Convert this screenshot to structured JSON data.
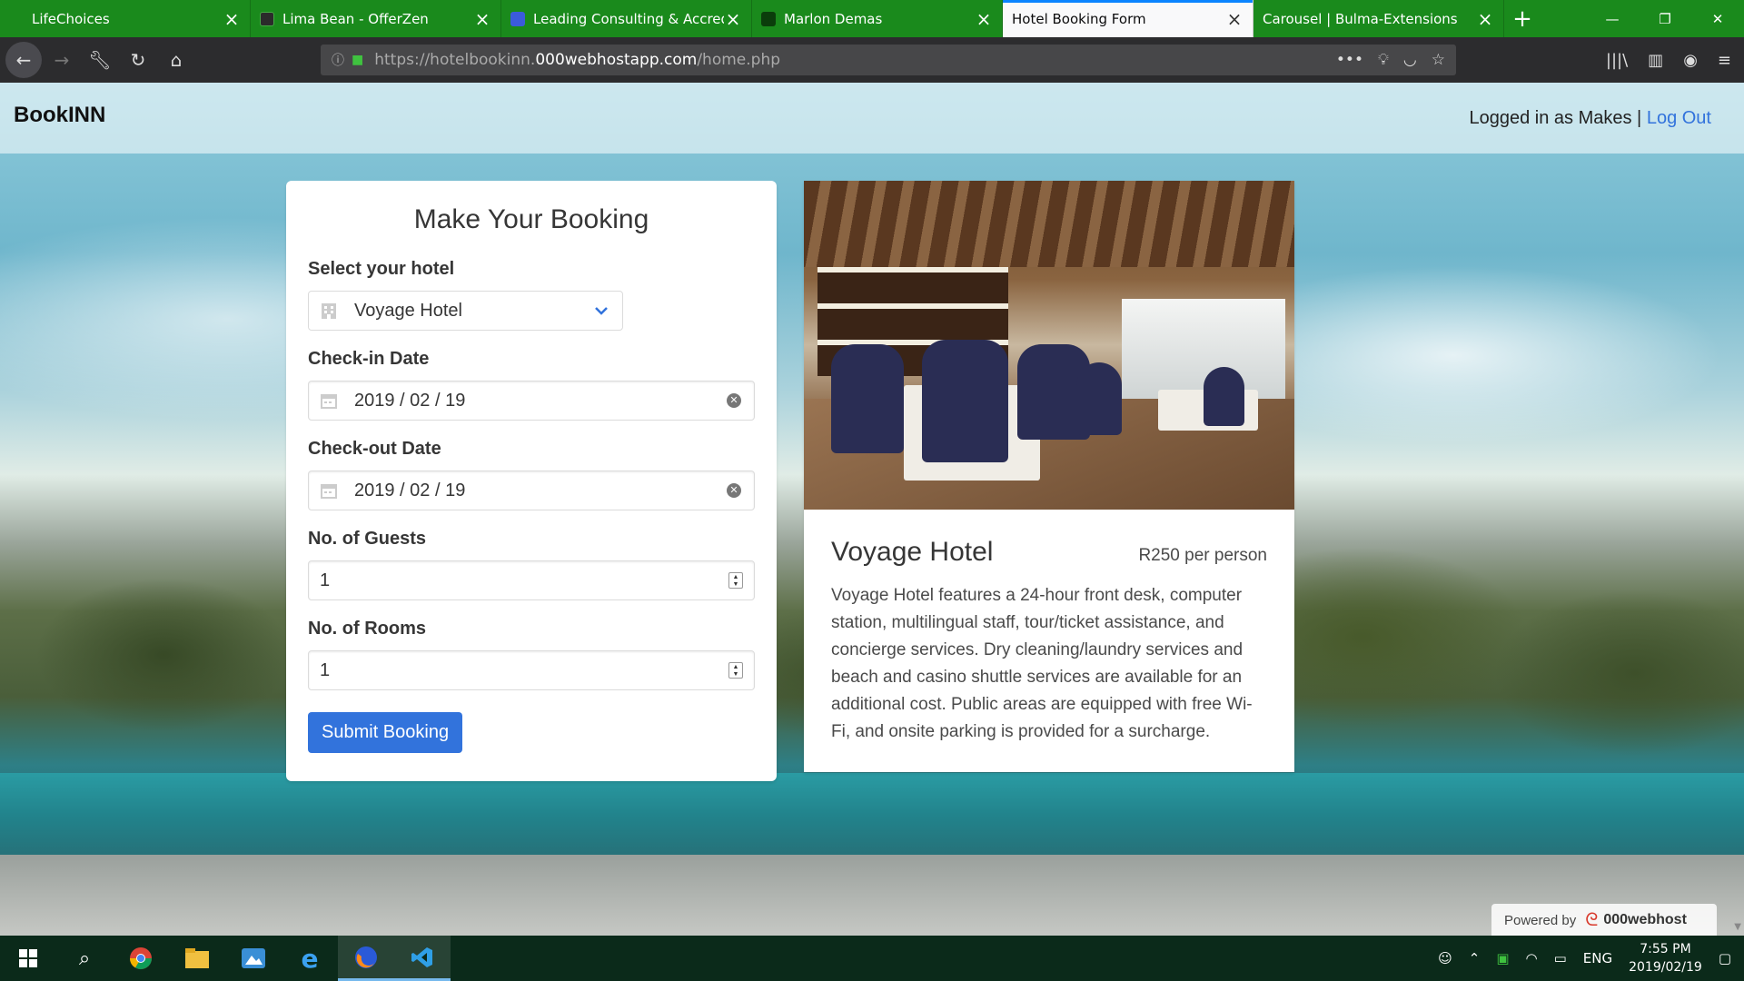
{
  "browser": {
    "tabs": [
      {
        "title": "LifeChoices",
        "icon_color": "#1a8a1c",
        "active": false
      },
      {
        "title": "Lima Bean - OfferZen",
        "icon_color": "#2b2b2b",
        "active": false
      },
      {
        "title": "Leading Consulting & Accredit",
        "icon_color": "#3b5bdb",
        "active": false
      },
      {
        "title": "Marlon Demas",
        "icon_color": "#0b3d0b",
        "active": false
      },
      {
        "title": "Hotel Booking Form",
        "icon_color": "#f9f9fa",
        "active": true
      },
      {
        "title": "Carousel | Bulma-Extensions",
        "icon_color": "#1a8a1c",
        "active": false
      }
    ],
    "url_prefix": "https://hotelbookinn.",
    "url_domain": "000webhostapp.com",
    "url_path": "/home.php"
  },
  "navbar": {
    "brand": "BookINN",
    "logged_in_text": "Logged in as Makes |",
    "logout_label": "Log Out"
  },
  "booking_form": {
    "title": "Make Your Booking",
    "hotel_label": "Select your hotel",
    "hotel_value": "Voyage Hotel",
    "checkin_label": "Check-in Date",
    "checkin_value": "2019 / 02 / 19",
    "checkout_label": "Check-out Date",
    "checkout_value": "2019 / 02 / 19",
    "guests_label": "No. of Guests",
    "guests_value": "1",
    "rooms_label": "No. of Rooms",
    "rooms_value": "1",
    "submit_label": "Submit Booking"
  },
  "hotel_card": {
    "name": "Voyage Hotel",
    "price": "R250 per person",
    "description": "Voyage Hotel features a 24-hour front desk, computer station, multilingual staff, tour/ticket assistance, and concierge services. Dry cleaning/laundry services and beach and casino shuttle services are available for an additional cost. Public areas are equipped with free Wi-Fi, and onsite parking is provided for a surcharge."
  },
  "powered_by": {
    "prefix": "Powered by",
    "brand": "000webhost"
  },
  "taskbar": {
    "language": "ENG",
    "time": "7:55 PM",
    "date": "2019/02/19"
  },
  "colors": {
    "accent": "#3273dc",
    "tab_bar": "#1a8a1c"
  }
}
